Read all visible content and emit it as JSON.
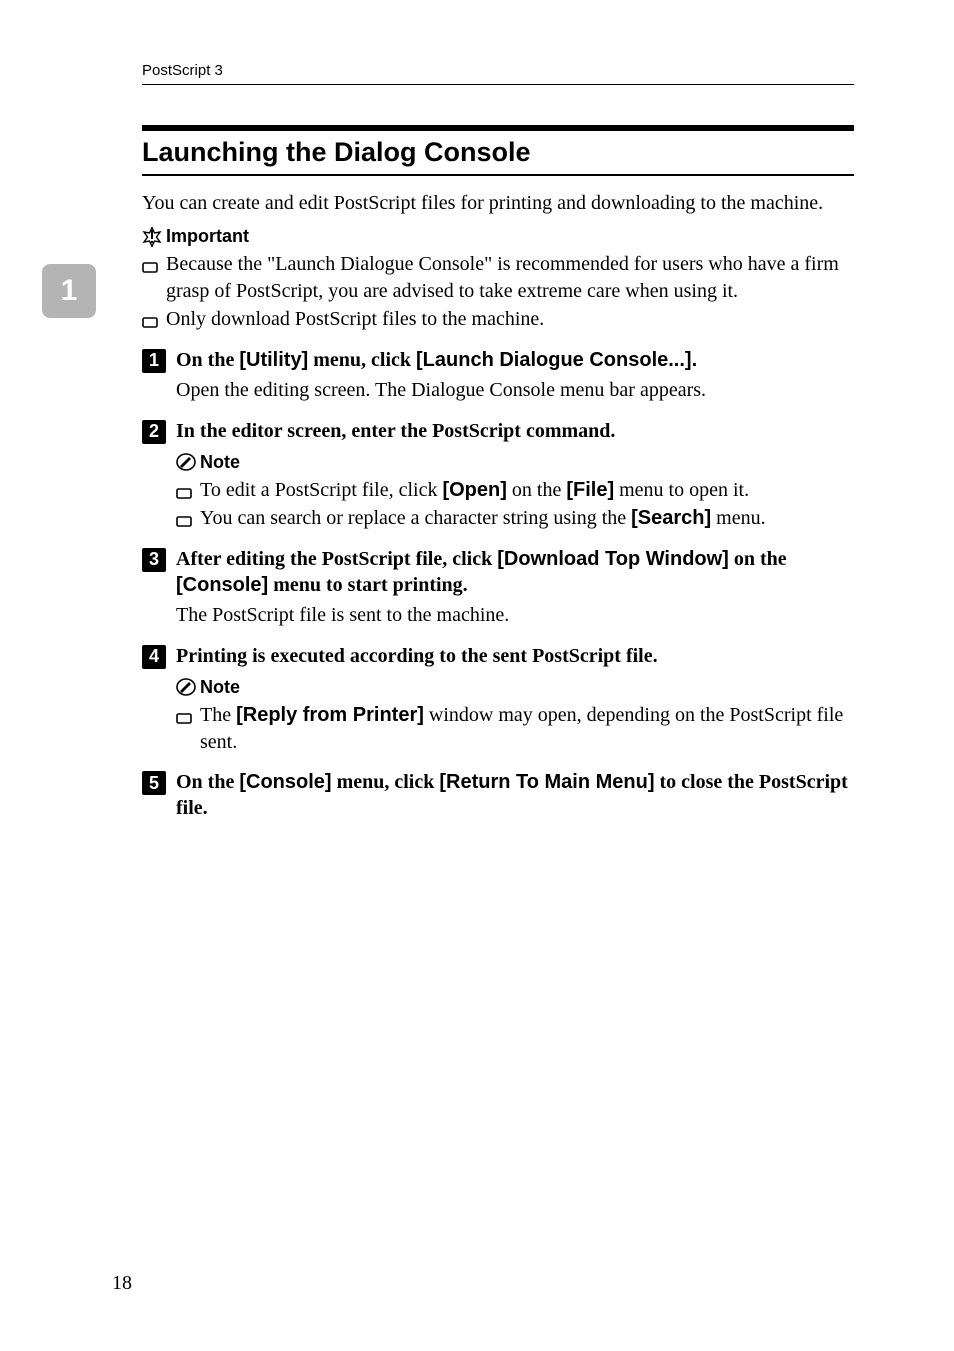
{
  "header": {
    "left": "PostScript 3"
  },
  "side_tab": {
    "number": "1"
  },
  "section": {
    "title": "Launching the Dialog Console"
  },
  "intro": "You can create and edit PostScript files for printing and downloading to the machine.",
  "important": {
    "label": "Important",
    "items": [
      "Because the \"Launch Dialogue Console\" is recommended for users who have a firm grasp of PostScript, you are advised to take extreme care when using it.",
      "Only download PostScript files to the machine."
    ]
  },
  "steps": {
    "1": {
      "parts": {
        "a": "On the ",
        "b": "[Utility]",
        "c": " menu, click ",
        "d": "[Launch Dialogue Console...]."
      },
      "follow": "Open the editing screen. The Dialogue Console menu bar appears."
    },
    "2": {
      "text": "In the editor screen, enter the PostScript command.",
      "note_label": "Note",
      "notes": {
        "1": {
          "a": "To edit a PostScript file, click ",
          "b": "[Open]",
          "c": " on the ",
          "d": "[File]",
          "e": " menu to open it."
        },
        "2": {
          "a": "You can search or replace a character string using the ",
          "b": "[Search]",
          "c": " menu."
        }
      }
    },
    "3": {
      "parts": {
        "a": "After editing the PostScript file, click ",
        "b": "[Download Top Window]",
        "c": " on the ",
        "d": "[Console]",
        "e": " menu to start printing."
      },
      "follow": "The PostScript file is sent to the machine."
    },
    "4": {
      "text": "Printing is executed according to the sent PostScript file.",
      "note_label": "Note",
      "notes": {
        "1": {
          "a": "The ",
          "b": "[Reply from Printer]",
          "c": " window may open, depending on the PostScript file sent."
        }
      }
    },
    "5": {
      "parts": {
        "a": "On the ",
        "b": "[Console]",
        "c": " menu, click ",
        "d": "[Return To Main Menu]",
        "e": " to close the PostScript file."
      }
    }
  },
  "page_number": "18"
}
